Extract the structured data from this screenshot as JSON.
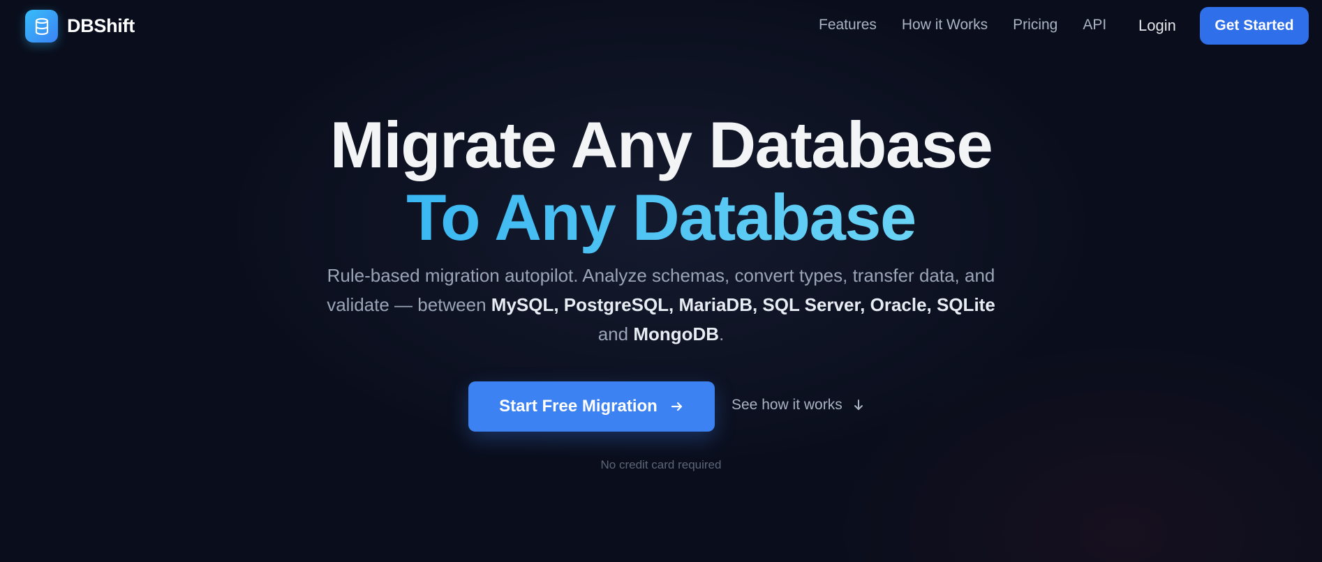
{
  "nav": {
    "brand": "DBShift",
    "links": [
      "Features",
      "How it Works",
      "Pricing",
      "API"
    ],
    "login": "Login",
    "cta": "Get Started",
    "logo_icon": "database-icon"
  },
  "hero": {
    "title_line1": "Migrate Any Database",
    "title_line2": "To Any Database",
    "subtitle_prefix": "Rule-based migration autopilot. Analyze schemas, convert types, transfer data, and validate — between ",
    "databases_list": "MySQL, PostgreSQL, MariaDB, SQL Server, Oracle, SQLite",
    "subtitle_and": " and ",
    "database_last": "MongoDB",
    "subtitle_end": ".",
    "primary_cta": "Start Free Migration",
    "primary_cta_icon": "arrow-right-icon",
    "secondary_cta": "See how it works",
    "secondary_cta_icon": "arrow-down-icon",
    "note": "No credit card required"
  },
  "colors": {
    "background": "#0a0e1c",
    "accent": "#2f6fe9",
    "primary_button": "#3c82f3",
    "highlight": "#54c6f3"
  }
}
